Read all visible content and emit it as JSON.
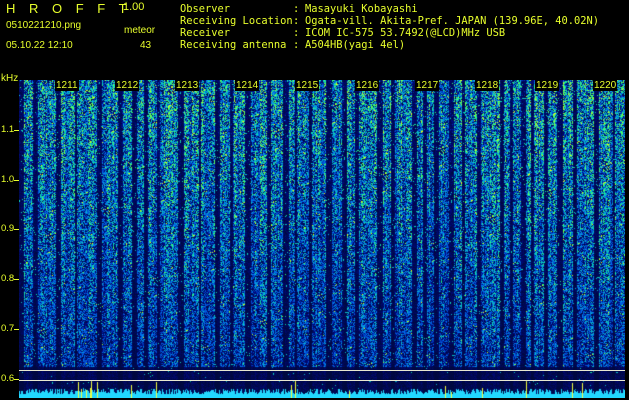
{
  "header": {
    "app_name": "H R O F F T",
    "version": "1.00",
    "filename": "0510221210.png",
    "date_time": "05.10.22 12:10",
    "meteor_label": "meteor",
    "meteor_count": "43"
  },
  "info": [
    {
      "label": "Observer",
      "value": "Masayuki Kobayashi"
    },
    {
      "label": "Receiving Location",
      "value": "Ogata-vill. Akita-Pref. JAPAN (139.96E, 40.02N)"
    },
    {
      "label": "Receiver",
      "value": "ICOM IC-575 53.7492(@LCD)MHz USB"
    },
    {
      "label": "Receiving antenna",
      "value": "A504HB(yagi 4el)"
    }
  ],
  "axis": {
    "unit": "kHz",
    "y_ticks": [
      "1.1",
      "1.0",
      "0.9",
      "0.8",
      "0.7",
      "0.6"
    ],
    "time_labels": [
      "1211",
      "1212",
      "1213",
      "1214",
      "1215",
      "1216",
      "1217",
      "1218",
      "1219",
      "1220"
    ]
  },
  "colors": {
    "text": "#e8ff2c",
    "background": "#000000",
    "spectrum_low": "#00105a",
    "spectrum_mid": "#0a5aff",
    "spectrum_high": "#2aff7a"
  }
}
